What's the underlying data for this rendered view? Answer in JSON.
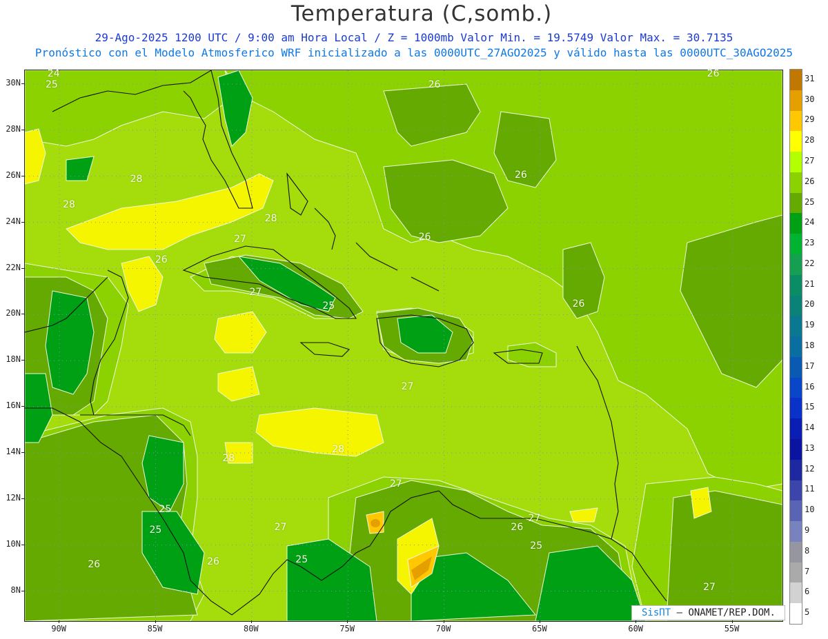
{
  "header": {
    "title": "Temperatura (C,somb.)",
    "subtitle1": "29-Ago-2025  1200 UTC / 9:00 am Hora Local / Z = 1000mb   Valor Min. = 19.5749  Valor Max. = 30.7135",
    "subtitle2": "Pronóstico con el Modelo Atmosferico WRF inicializado a las 0000UTC_27AGO2025 y válido hasta las  0000UTC_30AGO2025"
  },
  "axes": {
    "lat_labels": [
      "30N",
      "28N",
      "26N",
      "24N",
      "22N",
      "20N",
      "18N",
      "16N",
      "14N",
      "12N",
      "10N",
      "8N"
    ],
    "lat_values": [
      30,
      28,
      26,
      24,
      22,
      20,
      18,
      16,
      14,
      12,
      10,
      8
    ],
    "lon_labels": [
      "90W",
      "85W",
      "80W",
      "75W",
      "70W",
      "65W",
      "60W",
      "55W"
    ],
    "lon_values": [
      -90,
      -85,
      -80,
      -75,
      -70,
      -65,
      -60,
      -55
    ],
    "lat_range": [
      6.7,
      30.6
    ],
    "lon_range": [
      -91.8,
      -52.4
    ],
    "grid": "dotted"
  },
  "colorbar": {
    "levels": [
      "31",
      "30",
      "29",
      "28",
      "27",
      "26",
      "25",
      "24",
      "23",
      "22",
      "21",
      "20",
      "19",
      "18",
      "17",
      "16",
      "15",
      "14",
      "13",
      "12",
      "11",
      "10",
      "9",
      "8",
      "7",
      "6",
      "5"
    ],
    "colors": [
      "#c07800",
      "#e5a000",
      "#ffc800",
      "#ffff00",
      "#b4ff00",
      "#8cd200",
      "#64aa00",
      "#00a014",
      "#00b432",
      "#14a050",
      "#0a8c64",
      "#0a8278",
      "#0a7890",
      "#0a6ea0",
      "#0a5ab4",
      "#0a46c8",
      "#0a32c8",
      "#0a1eb4",
      "#0a14a0",
      "#1e28a0",
      "#3c46aa",
      "#5a64b4",
      "#7882be",
      "#9696a0",
      "#aaaaaa",
      "#d2d2d2",
      "#ffffff"
    ]
  },
  "map": {
    "contour_labels": [
      {
        "text": "24",
        "lon": -90.3,
        "lat": 30.4
      },
      {
        "text": "25",
        "lon": -90.4,
        "lat": 29.9
      },
      {
        "text": "26",
        "lon": -70.5,
        "lat": 29.9
      },
      {
        "text": "26",
        "lon": -56.0,
        "lat": 30.4
      },
      {
        "text": "28",
        "lon": -86.0,
        "lat": 25.8
      },
      {
        "text": "28",
        "lon": -89.5,
        "lat": 24.7
      },
      {
        "text": "26",
        "lon": -66.0,
        "lat": 26.0
      },
      {
        "text": "28",
        "lon": -79.0,
        "lat": 24.1
      },
      {
        "text": "26",
        "lon": -71.0,
        "lat": 23.3
      },
      {
        "text": "27",
        "lon": -80.6,
        "lat": 23.2
      },
      {
        "text": "26",
        "lon": -84.7,
        "lat": 22.3
      },
      {
        "text": "27",
        "lon": -79.8,
        "lat": 20.9
      },
      {
        "text": "25",
        "lon": -76.0,
        "lat": 20.3
      },
      {
        "text": "26",
        "lon": -63.0,
        "lat": 20.4
      },
      {
        "text": "27",
        "lon": -71.9,
        "lat": 16.8
      },
      {
        "text": "28",
        "lon": -75.5,
        "lat": 14.1
      },
      {
        "text": "28",
        "lon": -81.2,
        "lat": 13.7
      },
      {
        "text": "27",
        "lon": -72.5,
        "lat": 12.6
      },
      {
        "text": "25",
        "lon": -84.5,
        "lat": 11.5
      },
      {
        "text": "25",
        "lon": -85.0,
        "lat": 10.6
      },
      {
        "text": "27",
        "lon": -78.5,
        "lat": 10.7
      },
      {
        "text": "27",
        "lon": -65.3,
        "lat": 11.1
      },
      {
        "text": "26",
        "lon": -66.2,
        "lat": 10.7
      },
      {
        "text": "25",
        "lon": -65.2,
        "lat": 9.9
      },
      {
        "text": "26",
        "lon": -88.2,
        "lat": 9.1
      },
      {
        "text": "26",
        "lon": -82.0,
        "lat": 9.2
      },
      {
        "text": "25",
        "lon": -77.4,
        "lat": 9.3
      },
      {
        "text": "27",
        "lon": -56.2,
        "lat": 8.1
      }
    ]
  },
  "credit": {
    "brand": "SisПТ",
    "text": "– ONAMET/REP.DOM."
  }
}
